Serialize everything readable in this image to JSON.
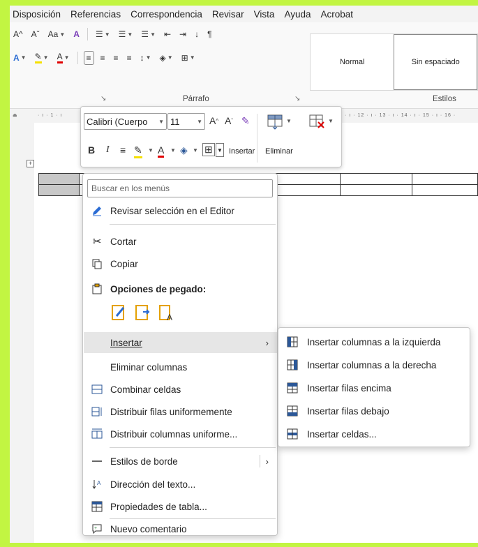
{
  "menubar": {
    "items": [
      "Disposición",
      "Referencias",
      "Correspondencia",
      "Revisar",
      "Vista",
      "Ayuda",
      "Acrobat"
    ]
  },
  "ribbon": {
    "font_row": {
      "grow": "A^",
      "shrink": "Aˇ",
      "case": "Aa",
      "clear": "A"
    },
    "paragraph_label": "Párrafo",
    "styles_label": "Estilos",
    "styles": [
      "Normal",
      "Sin espaciado"
    ]
  },
  "ruler": {
    "left_text": "· ı · 1 · ı",
    "right_text": "· ı · 12 · ı · 13 · ı · 14 · ı · 15 · ı · 16 ·"
  },
  "mini_toolbar": {
    "font_name": "Calibri (Cuerpo",
    "font_size": "11",
    "insert_label": "Insertar",
    "delete_label": "Eliminar",
    "bold": "B",
    "italic": "I"
  },
  "context_menu": {
    "search_placeholder": "Buscar en los menús",
    "items": {
      "editor": "Revisar selección en el Editor",
      "cut": "Cortar",
      "copy": "Copiar",
      "paste_options": "Opciones de pegado:",
      "insert": "Insertar",
      "delete_columns": "Eliminar columnas",
      "merge_cells": "Combinar celdas",
      "distribute_rows": "Distribuir filas uniformemente",
      "distribute_cols": "Distribuir columnas uniforme...",
      "border_styles": "Estilos de borde",
      "text_direction": "Dirección del texto...",
      "table_properties": "Propiedades de tabla...",
      "new_comment": "Nuevo comentario"
    }
  },
  "insert_submenu": {
    "items": [
      "Insertar columnas a la izquierda",
      "Insertar columnas a la derecha",
      "Insertar filas encima",
      "Insertar filas debajo",
      "Insertar celdas..."
    ]
  },
  "colors": {
    "background": "#c2f542",
    "highlight_yellow": "#f5e000",
    "font_red": "#e00000",
    "icon_blue": "#2b5797"
  }
}
